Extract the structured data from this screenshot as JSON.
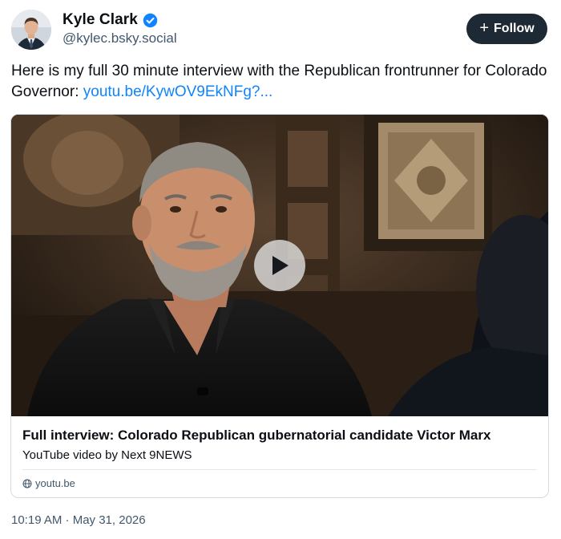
{
  "author": {
    "display_name": "Kyle Clark",
    "handle": "@kylec.bsky.social",
    "verified": true,
    "avatar_icon": "avatar-photo"
  },
  "follow_button": {
    "label": "Follow",
    "icon": "plus-icon"
  },
  "post": {
    "text": "Here is my full 30 minute interview with the Republican frontrunner for Colorado Governor: ",
    "link_text": "youtu.be/KywOV9EkNFg?..."
  },
  "embed": {
    "title": "Full interview: Colorado Republican gubernatorial candidate Victor Marx",
    "description": "YouTube video by Next 9NEWS",
    "domain": "youtu.be",
    "domain_icon": "globe-icon",
    "play_icon": "play-icon"
  },
  "timestamp": "10:19 AM · May 31, 2026",
  "colors": {
    "link": "#1083fe",
    "follow_bg": "#1e2936",
    "verified": "#1083fe",
    "secondary_text": "#42576c"
  }
}
